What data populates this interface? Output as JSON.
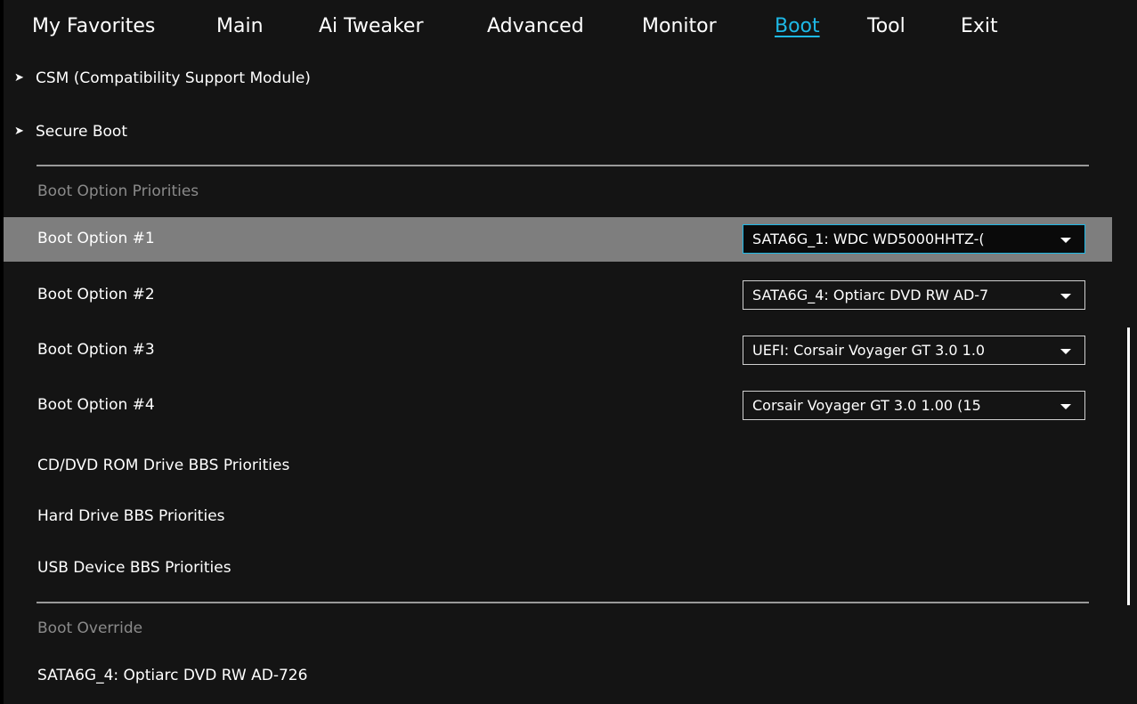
{
  "menu": {
    "tabs": [
      {
        "label": "My Favorites"
      },
      {
        "label": "Main"
      },
      {
        "label": "Ai Tweaker"
      },
      {
        "label": "Advanced"
      },
      {
        "label": "Monitor"
      },
      {
        "label": "Boot"
      },
      {
        "label": "Tool"
      },
      {
        "label": "Exit"
      }
    ],
    "active_tab": "Boot"
  },
  "boot": {
    "submenus": [
      {
        "label": "CSM (Compatibility Support Module)",
        "icon": "triangle-right-icon"
      },
      {
        "label": "Secure Boot",
        "icon": "triangle-right-icon"
      }
    ],
    "priorities_header": "Boot Option Priorities",
    "options": [
      {
        "label": "Boot Option #1",
        "value": "SATA6G_1: WDC WD5000HHTZ-(",
        "selected": true
      },
      {
        "label": "Boot Option #2",
        "value": "SATA6G_4: Optiarc DVD RW AD-7",
        "selected": false
      },
      {
        "label": "Boot Option #3",
        "value": "UEFI: Corsair Voyager GT 3.0 1.0",
        "selected": false
      },
      {
        "label": "Boot Option #4",
        "value": "Corsair Voyager GT 3.0 1.00  (15",
        "selected": false
      }
    ],
    "bbs": [
      {
        "label": "CD/DVD ROM Drive BBS Priorities"
      },
      {
        "label": "Hard Drive BBS Priorities"
      },
      {
        "label": "USB Device BBS Priorities"
      }
    ],
    "override_header": "Boot Override",
    "override_items": [
      {
        "label": "SATA6G_4: Optiarc DVD RW AD-726"
      }
    ]
  },
  "colors": {
    "background": "#141414",
    "accent": "#1eb8e6",
    "highlight_row": "#7e7e7e",
    "section_header": "#8a8a8a"
  }
}
